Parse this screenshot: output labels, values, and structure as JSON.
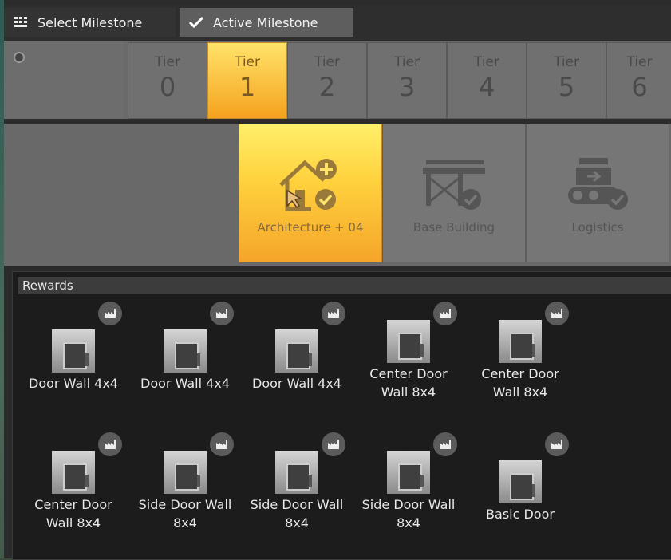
{
  "tabs": [
    {
      "label": "Select Milestone",
      "icon": "grid-icon"
    },
    {
      "label": "Active Milestone",
      "icon": "checkmark-icon"
    }
  ],
  "tiers": [
    {
      "label": "Tier",
      "number": "0"
    },
    {
      "label": "Tier",
      "number": "1"
    },
    {
      "label": "Tier",
      "number": "2"
    },
    {
      "label": "Tier",
      "number": "3"
    },
    {
      "label": "Tier",
      "number": "4"
    },
    {
      "label": "Tier",
      "number": "5"
    },
    {
      "label": "Tier",
      "number": "6"
    }
  ],
  "selected_tier": "1",
  "milestones": [
    {
      "name": "Architecture + 04",
      "icon": "house-plus-icon",
      "selected": true
    },
    {
      "name": "Base Building",
      "icon": "conveyor-frame-icon",
      "selected": false
    },
    {
      "name": "Logistics",
      "icon": "conveyor-belt-icon",
      "selected": false
    }
  ],
  "rewards": {
    "title": "Rewards",
    "items": [
      {
        "line1": "Door Wall 4x4",
        "line2": ""
      },
      {
        "line1": "Door Wall 4x4",
        "line2": ""
      },
      {
        "line1": "Door Wall 4x4",
        "line2": ""
      },
      {
        "line1": "Center Door",
        "line2": "Wall 8x4"
      },
      {
        "line1": "Center Door",
        "line2": "Wall 8x4"
      },
      {
        "line1": "Center Door",
        "line2": "Wall 8x4"
      },
      {
        "line1": "Side Door Wall",
        "line2": "8x4"
      },
      {
        "line1": "Side Door Wall",
        "line2": "8x4"
      },
      {
        "line1": "Side Door Wall",
        "line2": "8x4"
      },
      {
        "line1": "Basic Door",
        "line2": ""
      }
    ],
    "badge_icon": "factory-icon"
  },
  "colors": {
    "accent_orange": "#f5a21e",
    "accent_yellow": "#ffe36a"
  }
}
